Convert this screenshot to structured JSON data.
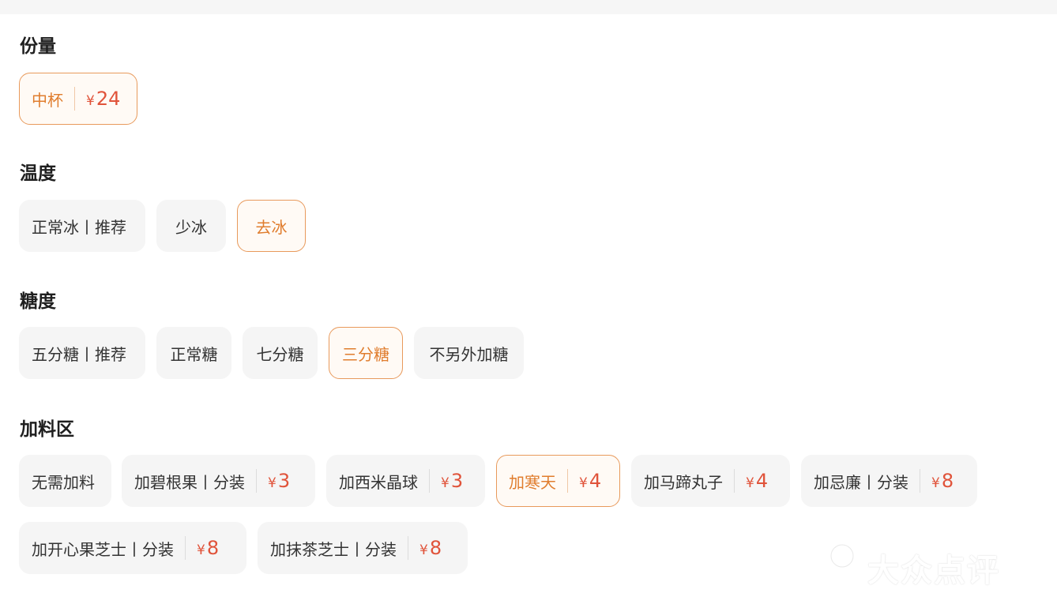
{
  "sections": {
    "size": {
      "title": "份量",
      "options": [
        {
          "label": "中杯",
          "price": "24"
        }
      ]
    },
    "temperature": {
      "title": "温度",
      "options": [
        {
          "label": "正常冰丨推荐"
        },
        {
          "label": "少冰"
        },
        {
          "label": "去冰"
        }
      ]
    },
    "sugar": {
      "title": "糖度",
      "options": [
        {
          "label": "五分糖丨推荐"
        },
        {
          "label": "正常糖"
        },
        {
          "label": "七分糖"
        },
        {
          "label": "三分糖"
        },
        {
          "label": "不另外加糖"
        }
      ]
    },
    "toppings": {
      "title": "加料区",
      "options": [
        {
          "label": "无需加料"
        },
        {
          "label": "加碧根果丨分装",
          "price": "3"
        },
        {
          "label": "加西米晶球",
          "price": "3"
        },
        {
          "label": "加寒天",
          "price": "4"
        },
        {
          "label": "加马蹄丸子",
          "price": "4"
        },
        {
          "label": "加忌廉丨分装",
          "price": "8"
        },
        {
          "label": "加开心果芝士丨分装",
          "price": "8"
        },
        {
          "label": "加抹茶芝士丨分装",
          "price": "8"
        }
      ]
    }
  },
  "currency_symbol": "¥",
  "selected": {
    "size": "中杯",
    "temperature": "去冰",
    "sugar": "三分糖",
    "toppings": "加寒天"
  },
  "watermark": "大众点评",
  "colors": {
    "accent": "#e07d2e",
    "accent_border": "#e89a5c",
    "price": "#e0533a",
    "chip_bg": "#f5f5f5"
  }
}
